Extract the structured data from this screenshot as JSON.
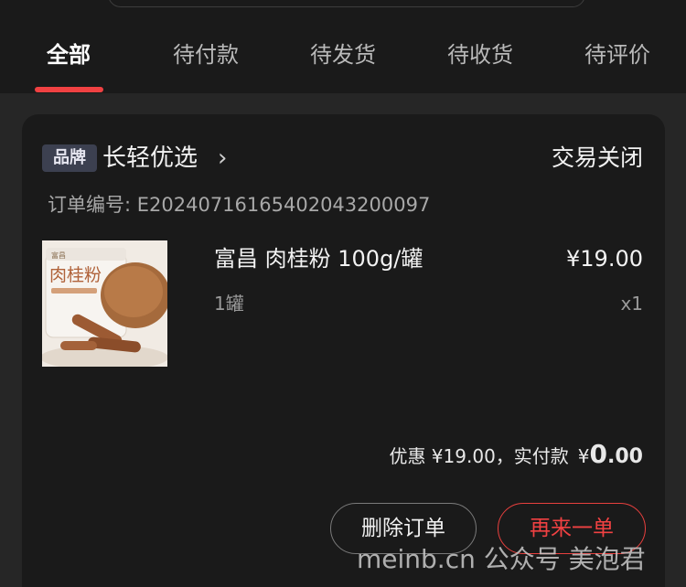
{
  "tabs": [
    {
      "label": "全部",
      "active": true
    },
    {
      "label": "待付款",
      "active": false
    },
    {
      "label": "待发货",
      "active": false
    },
    {
      "label": "待收货",
      "active": false
    },
    {
      "label": "待评价",
      "active": false
    }
  ],
  "order": {
    "brand_badge": "品牌",
    "shop_name": "长轻优选",
    "status": "交易关闭",
    "order_number_text": "订单编号: E20240716165402043200097",
    "product": {
      "image_label": "肉桂粉",
      "image_brand": "富昌",
      "title": "富昌 肉桂粉 100g/罐",
      "price": "¥19.00",
      "spec": "1罐",
      "quantity": "x1"
    },
    "summary": {
      "discount_text": "优惠 ¥19.00，实付款",
      "paid_symbol": "¥",
      "paid_integer": "0",
      "paid_decimal": ".00"
    },
    "actions": {
      "delete_label": "删除订单",
      "rebuy_label": "再来一单"
    }
  },
  "watermark": "meinb.cn 公众号 美泡君",
  "colors": {
    "accent_red": "#f04142",
    "background": "#262626",
    "card": "#1a1a1a"
  }
}
